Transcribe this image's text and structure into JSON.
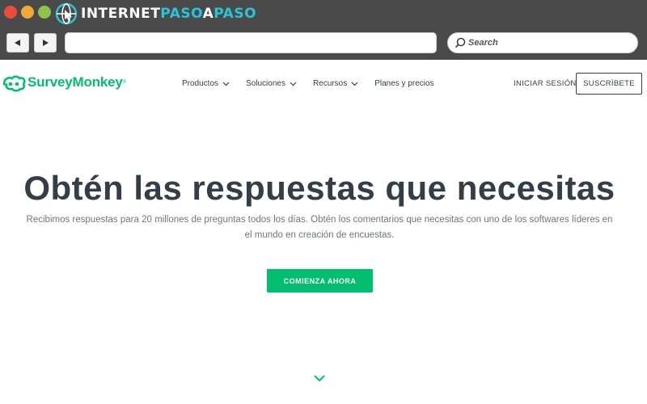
{
  "browser": {
    "brand_part1": "INTERNET",
    "brand_part2": "PASO",
    "brand_part3": "A",
    "brand_part4": "PASO",
    "back_icon": "triangle-left",
    "forward_icon": "triangle-right",
    "url": "",
    "search_placeholder": "Search"
  },
  "site": {
    "logo_name": "SurveyMonkey",
    "logo_reg": "®",
    "nav": [
      {
        "label": "Productos",
        "has_dropdown": true
      },
      {
        "label": "Soluciones",
        "has_dropdown": true
      },
      {
        "label": "Recursos",
        "has_dropdown": true
      },
      {
        "label": "Planes y precios",
        "has_dropdown": false
      }
    ],
    "login_label": "INICIAR SESIÓN",
    "signup_label": "SUSCRÍBETE"
  },
  "hero": {
    "title": "Obtén las respuestas que necesitas",
    "subtitle_line1": "Recibimos respuestas para 20 millones de preguntas todos los días. Obtén los comentarios que necesitas con uno de los softwares líderes en",
    "subtitle_line2": "el mundo en creación de encuestas.",
    "cta_label": "COMIENZA AHORA"
  },
  "colors": {
    "brand_green": "#00bf6f",
    "text_dark": "#333e48",
    "chrome": "#4a4a4a",
    "accent_cyan": "#2bc4d6"
  }
}
